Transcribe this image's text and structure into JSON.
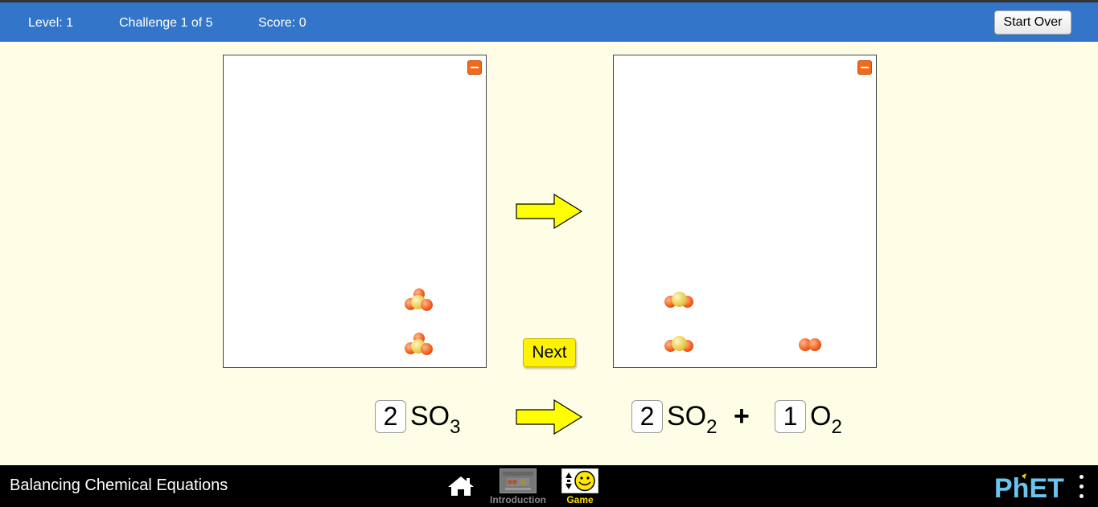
{
  "header": {
    "level": "Level: 1",
    "challenge": "Challenge 1 of 5",
    "score": "Score: 0",
    "start_over_label": "Start Over"
  },
  "reactants_box": {
    "molecules": [
      "SO3",
      "SO3"
    ]
  },
  "products_box": {
    "molecules": [
      "SO2",
      "SO2",
      "O2"
    ]
  },
  "next_label": "Next",
  "equation": {
    "reactants": [
      {
        "coefficient": "2",
        "symbol": "SO",
        "subscript": "3"
      }
    ],
    "products": [
      {
        "coefficient": "2",
        "symbol": "SO",
        "subscript": "2"
      },
      {
        "coefficient": "1",
        "symbol": "O",
        "subscript": "2"
      }
    ],
    "plus": "+"
  },
  "navbar": {
    "title": "Balancing Chemical Equations",
    "screens": [
      {
        "label": "Introduction",
        "icon": "introduction-screen-icon",
        "selected": false
      },
      {
        "label": "Game",
        "icon": "game-screen-icon",
        "selected": true
      }
    ],
    "logo_text": "PhET"
  },
  "colors": {
    "header_bg": "#3375c8",
    "page_bg": "#fefde6",
    "arrow_fill": "#ffff00",
    "next_button": "#fff200",
    "minimize_button": "#f26b1d",
    "oxygen": "#f05a1a",
    "sulfur": "#e8c84a",
    "game_label": "#ffe000",
    "phet_blue": "#6ac4f0"
  }
}
